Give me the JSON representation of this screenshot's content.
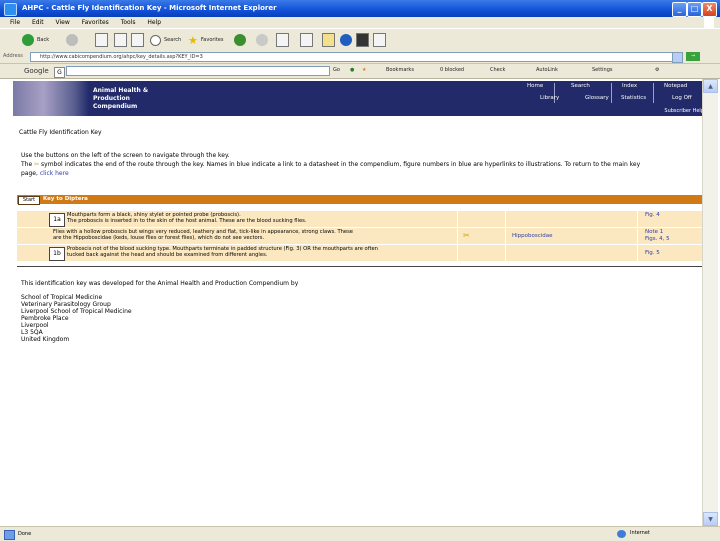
{
  "window": {
    "title": "AHPC - Cattle Fly Identification Key - Microsoft Internet Explorer",
    "controls": {
      "minimize": "_",
      "maximize": "□",
      "close": "X"
    }
  },
  "menu": [
    "File",
    "Edit",
    "View",
    "Favorites",
    "Tools",
    "Help"
  ],
  "toolbar": {
    "back": "Back",
    "search": "Search",
    "favorites": "Favorites"
  },
  "address": {
    "label": "Address",
    "url": "http://www.cabicompendium.org/ahpc/key_details.asp?KEY_ID=3"
  },
  "google": {
    "logo": "Google",
    "go": "Go",
    "bookmarks": "Bookmarks",
    "blocked": "0 blocked",
    "check": "Check",
    "autolink": "AutoLink",
    "settings": "Settings"
  },
  "banner": {
    "title": "Animal Health &\nProduction\nCompendium",
    "nav_top": [
      "Home",
      "Search",
      "Index",
      "Notepad"
    ],
    "nav_bottom": [
      "Library",
      "Glossary",
      "Statistics",
      "Log Off"
    ],
    "logout": "Subscriber Help"
  },
  "page": {
    "heading": "Cattle Fly Identification Key",
    "intro_1": "Use the buttons on the left of the screen to navigate through the key.",
    "intro_2a": "The ",
    "intro_2b": " symbol indicates the end of the route through the key. Names in blue indicate a link to a datasheet in the compendium, figure numbers in blue are hyperlinks to illustrations. To return to the main key",
    "intro_3a": "page, ",
    "intro_3b": "click here",
    "key_header": {
      "start": "Start",
      "label": "Key to Diptera"
    },
    "rows": [
      {
        "num": "1a",
        "text": "Mouthparts form a black, shiny stylet or pointed probe (proboscis).\nThe proboscis is inserted in to the skin of the host animal. These are the blood sucking flies.",
        "family": "",
        "goto": "Fig. 4"
      },
      {
        "num": "2b",
        "text": "Flies with a hollow proboscis but wings very reduced, leathery and flat, tick-like in appearance, strong claws. These\nare the Hippoboscidae (keds, louse flies or forest flies), which do not see vectors.",
        "family": "Hippoboscidae",
        "goto": "Note 1\nFigs. 4, 5"
      },
      {
        "num": "1b",
        "text": "Proboscis not of the blood sucking type. Mouthparts terminate in padded structure (Fig. 3) OR the mouthparts are often\ntucked back against the head and should be examined from different angles.",
        "family": "",
        "goto": "Fig. 5"
      }
    ],
    "credit": "This identification key was developed for the Animal Health and Production Compendium by",
    "address": "School of Tropical Medicine\nVeterinary Parasitology Group\nLiverpool School of Tropical Medicine\nPembroke Place\nLiverpool\nL3 5QA\nUnited Kingdom"
  },
  "status": {
    "text": "Done",
    "zone": "Internet"
  }
}
